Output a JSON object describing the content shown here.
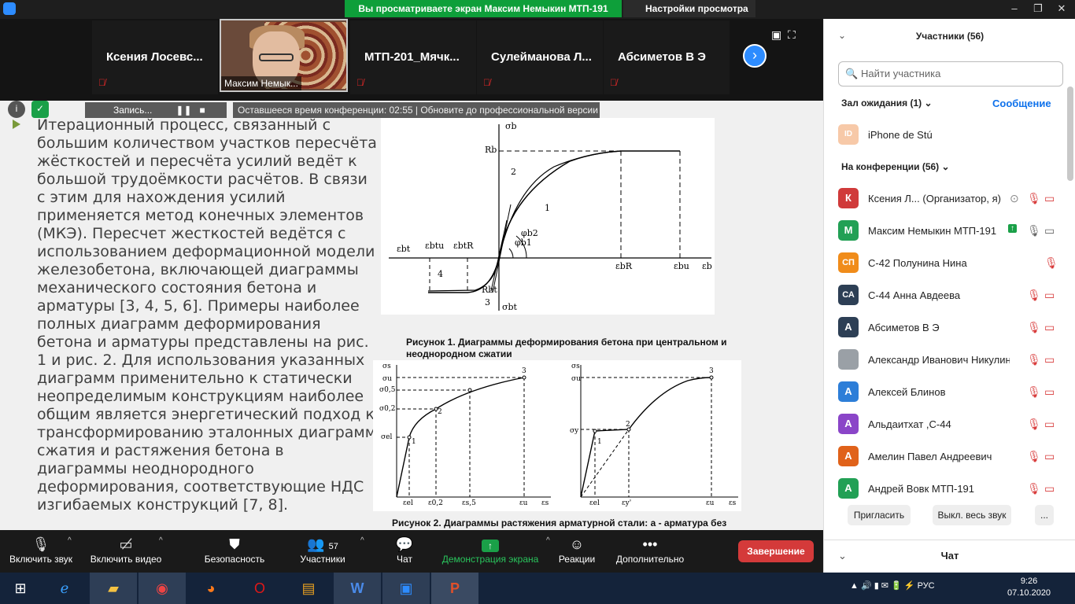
{
  "banner": {
    "sharing": "Вы просматриваете экран Максим Немыкин МТП-191",
    "view_options": "Настройки просмотра"
  },
  "window_controls": {
    "min": "–",
    "restore": "❐",
    "close": "✕"
  },
  "participants_strip": [
    {
      "name": "Ксения  Лосевс...",
      "muted": true
    },
    {
      "name": "Максим Немык...",
      "video": true
    },
    {
      "name": "МТП-201_Мячк...",
      "muted": true
    },
    {
      "name": "Сулейманова  Л...",
      "muted": true
    },
    {
      "name": "Абсиметов В Э",
      "muted": true
    }
  ],
  "recording": {
    "label": "Запись...",
    "remaining": "Оставшееся время конференции: 02:55 | Обновите до профессиональной версии"
  },
  "slide": {
    "text": "Итерационный процесс, связанный с большим количеством участков пересчёта жёсткостей и пересчёта усилий ведёт к большой трудоёмкости расчётов. В связи с этим для нахождения усилий применяется метод конечных элементов (МКЭ). Пересчет жесткостей ведётся с использованием деформационной модели железобетона, включающей диаграммы механического состояния бетона и арматуры [3, 4, 5, 6]. Примеры наиболее полных диаграмм деформирования бетона и арматуры представлены на рис. 1 и рис. 2. Для использования указанных диаграмм применительно к статически неопределимым конструкциям наиболее общим является энергетический подход к трансформированию эталонных диаграмм сжатия и растяжения бетона в диаграммы неоднородного деформирования, соответствующие НДС изгибаемых конструкций [7, 8].",
    "fig1_caption": "Рисунок 1. Диаграммы деформирования бетона при центральном и неоднородном сжатии",
    "fig2_caption": "Рисунок 2. Диаграммы растяжения арматурной стали: а - арматура без",
    "fig1_labels": {
      "sb": "σb",
      "Rb": "Rb",
      "Rbt": "Rbt",
      "sbt": "σbt",
      "ebt": "εbt",
      "ebtu": "εbtu",
      "ebtR": "εbtR",
      "ebR": "εbR",
      "ebu": "εbu",
      "eb": "εb",
      "n1": "1",
      "n2": "2",
      "n3": "3",
      "n4": "4",
      "phi_b1": "φb1",
      "phi_b2": "φb2"
    },
    "fig2_labels": {
      "s": "σs",
      "su": "σu",
      "s02": "σ0,2",
      "s05": "σ0,5",
      "se": "σel",
      "n1": "1",
      "n2": "2",
      "n3": "3",
      "ee": "εel",
      "e02": "ε0,2",
      "e05": "εs,5",
      "eu": "εu",
      "es": "εs",
      "b_s": "σs",
      "b_su": "σu",
      "b_sy": "σy",
      "b_ey": "εel",
      "b_eyp": "εy'",
      "b_eu": "εu"
    }
  },
  "toolbar": [
    {
      "label": "Включить звук",
      "icon": "mic-off-icon"
    },
    {
      "label": "Включить видео",
      "icon": "video-off-icon"
    },
    {
      "label": "Безопасность",
      "icon": "shield-icon"
    },
    {
      "label": "Участники",
      "icon": "people-icon",
      "count": "57"
    },
    {
      "label": "Чат",
      "icon": "chat-icon"
    },
    {
      "label": "Демонстрация экрана",
      "icon": "share-icon"
    },
    {
      "label": "Реакции",
      "icon": "emoji-icon"
    },
    {
      "label": "Дополнительно",
      "icon": "more-icon"
    }
  ],
  "end_button": "Завершение",
  "panel": {
    "title": "Участники (56)",
    "search_placeholder": "Найти участника",
    "waiting": "Зал ожидания (1)",
    "message": "Сообщение",
    "waiting_user": {
      "initials": "ID",
      "name": "iPhone de Stú",
      "color": "#f7c9a8"
    },
    "in_meeting": "На конференции (56)",
    "people": [
      {
        "initials": "К",
        "name": "Ксения Л...  (Организатор, я)",
        "color": "#d03a3a"
      },
      {
        "initials": "М",
        "name": "Максим Немыкин МТП-191",
        "color": "#22a055"
      },
      {
        "initials": "СП",
        "name": "С-42 Полунина Нина",
        "color": "#f08c1a"
      },
      {
        "initials": "СА",
        "name": "С-44 Анна Авдеева",
        "color": "#2d3f55"
      },
      {
        "initials": "А",
        "name": "Абсиметов В Э",
        "color": "#2d3f55"
      },
      {
        "initials": "",
        "name": "Александр Иванович Никулин",
        "color": "#9aa0a6"
      },
      {
        "initials": "А",
        "name": "Алексей Блинов",
        "color": "#2d7ed8"
      },
      {
        "initials": "А",
        "name": "Альдаитхат ,С-44",
        "color": "#8a45c8"
      },
      {
        "initials": "А",
        "name": "Амелин Павел Андреевич",
        "color": "#e0621a"
      },
      {
        "initials": "А",
        "name": "Андрей Вовк МТП-191",
        "color": "#22a055"
      }
    ],
    "invite": "Пригласить",
    "mute_all": "Выкл. весь звук",
    "more": "...",
    "chat": "Чат"
  },
  "taskbar": {
    "lang": "РУС",
    "time": "9:26",
    "date": "07.10.2020"
  }
}
